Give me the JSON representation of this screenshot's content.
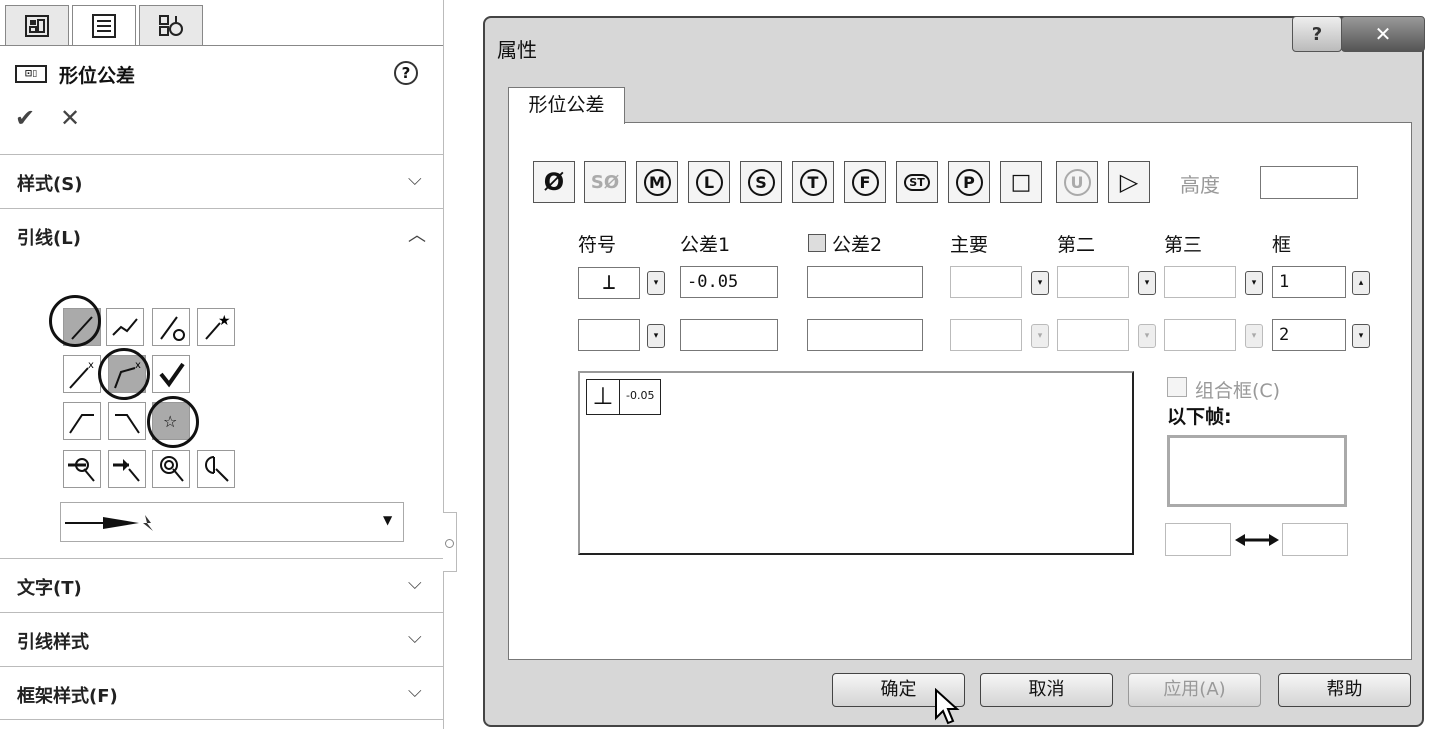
{
  "panel": {
    "title": "形位公差",
    "help": "?",
    "ok": "✔",
    "cancel": "✕",
    "sections": {
      "style": "样式(S)",
      "leader": "引线(L)",
      "text": "文字(T)",
      "leader_style": "引线样式",
      "frame_style": "框架样式(F)"
    },
    "arrow_select_caret": "▼"
  },
  "dialog": {
    "title": "属性",
    "help_btn": "?",
    "close_btn": "✕",
    "tab": "形位公差",
    "symbols": [
      "Ø",
      "SØ",
      "M",
      "L",
      "S",
      "T",
      "F",
      "ST",
      "P",
      "□",
      "U",
      "▷"
    ],
    "height_label": "高度",
    "columns": {
      "symbol": "符号",
      "tol1": "公差1",
      "tol2": "公差2",
      "primary": "主要",
      "secondary": "第二",
      "tertiary": "第三",
      "frame": "框"
    },
    "row1": {
      "symbol": "⊥",
      "tol1": "-0.05",
      "frame": "1"
    },
    "row2": {
      "frame": "2"
    },
    "preview": {
      "symbol": "⊥",
      "value": "-0.05"
    },
    "combine_label": "组合框(C)",
    "below_frame_label": "以下帧:",
    "buttons": {
      "ok": "确定",
      "cancel": "取消",
      "apply": "应用(A)",
      "help": "帮助"
    }
  }
}
